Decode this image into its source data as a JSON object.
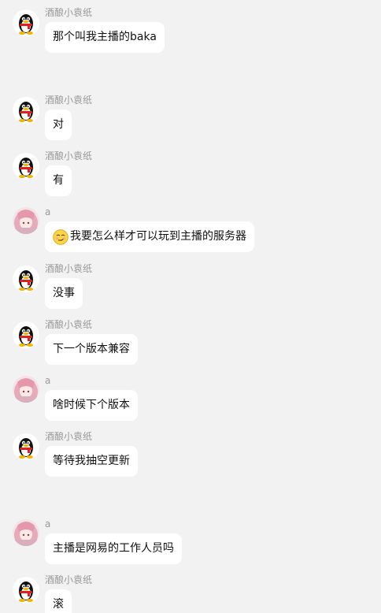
{
  "messages": [
    {
      "sender": "酒酿小袁纸",
      "avatar": "penguin-icon",
      "text": "那个叫我主播的baka"
    },
    {
      "sender": "酒酿小袁纸",
      "avatar": "penguin-icon",
      "text": "对"
    },
    {
      "sender": "酒酿小袁纸",
      "avatar": "penguin-icon",
      "text": "有"
    },
    {
      "sender": "a",
      "avatar": "anime-girl-avatar",
      "emoji": "smirk-emoji-icon",
      "text": "我要怎么样才可以玩到主播的服务器"
    },
    {
      "sender": "酒酿小袁纸",
      "avatar": "penguin-icon",
      "text": "没事"
    },
    {
      "sender": "酒酿小袁纸",
      "avatar": "penguin-icon",
      "text": "下一个版本兼容"
    },
    {
      "sender": "a",
      "avatar": "anime-girl-avatar",
      "text": "啥时候下个版本"
    },
    {
      "sender": "酒酿小袁纸",
      "avatar": "penguin-icon",
      "text": "等待我抽空更新"
    },
    {
      "sender": "a",
      "avatar": "anime-girl-avatar",
      "text": "主播是网易的工作人员吗"
    },
    {
      "sender": "酒酿小袁纸",
      "avatar": "penguin-icon",
      "text": "滚"
    }
  ]
}
